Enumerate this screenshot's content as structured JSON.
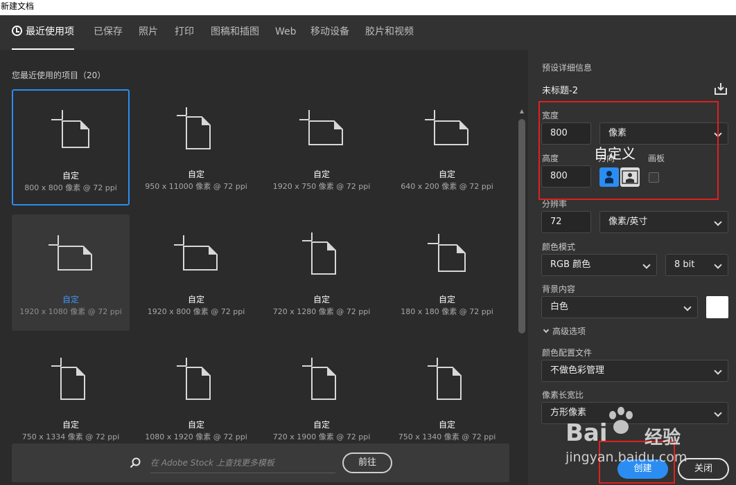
{
  "window": {
    "title": "新建文档"
  },
  "tabs": [
    {
      "label": "最近使用项",
      "active": true
    },
    {
      "label": "已保存"
    },
    {
      "label": "照片"
    },
    {
      "label": "打印"
    },
    {
      "label": "图稿和插图"
    },
    {
      "label": "Web"
    },
    {
      "label": "移动设备"
    },
    {
      "label": "胶片和视频"
    }
  ],
  "recent": {
    "heading": "您最近使用的项目（20）",
    "items": [
      {
        "name": "自定",
        "dim": "800 x 800 像素 @ 72 ppi",
        "orientation": "square",
        "state": "selected"
      },
      {
        "name": "自定",
        "dim": "950 x 11000 像素 @ 72 ppi",
        "orientation": "portrait"
      },
      {
        "name": "自定",
        "dim": "1920 x 750 像素 @ 72 ppi",
        "orientation": "landscape"
      },
      {
        "name": "自定",
        "dim": "640 x 200 像素 @ 72 ppi",
        "orientation": "landscape"
      },
      {
        "name": "自定",
        "dim": "1920 x 1080 像素 @ 72 ppi",
        "orientation": "landscape",
        "state": "hover"
      },
      {
        "name": "自定",
        "dim": "1920 x 800 像素 @ 72 ppi",
        "orientation": "landscape"
      },
      {
        "name": "自定",
        "dim": "720 x 1280 像素 @ 72 ppi",
        "orientation": "portrait"
      },
      {
        "name": "自定",
        "dim": "180 x 180 像素 @ 72 ppi",
        "orientation": "square"
      },
      {
        "name": "自定",
        "dim": "750 x 1334 像素 @ 72 ppi",
        "orientation": "portrait"
      },
      {
        "name": "自定",
        "dim": "1080 x 1920 像素 @ 72 ppi",
        "orientation": "portrait"
      },
      {
        "name": "自定",
        "dim": "720 x 1900 像素 @ 72 ppi",
        "orientation": "portrait"
      },
      {
        "name": "自定",
        "dim": "750 x 1340 像素 @ 72 ppi",
        "orientation": "portrait"
      }
    ]
  },
  "search": {
    "placeholder": "在 Adobe Stock 上查找更多模板",
    "button": "前往"
  },
  "preset": {
    "heading": "预设详细信息",
    "doc_name": "未标题-2",
    "width_label": "宽度",
    "width_value": "800",
    "width_unit": "像素",
    "height_label": "高度",
    "height_value": "800",
    "orientation_label": "方向",
    "artboard_label": "画板",
    "resolution_label": "分辨率",
    "resolution_value": "72",
    "resolution_unit": "像素/英寸",
    "color_mode_label": "颜色模式",
    "color_mode_value": "RGB 颜色",
    "bit_depth": "8 bit",
    "background_label": "背景内容",
    "background_value": "白色",
    "background_color": "#ffffff",
    "advanced_label": "高级选项",
    "color_profile_label": "颜色配置文件",
    "color_profile_value": "不做色彩管理",
    "pixel_aspect_label": "像素长宽比",
    "pixel_aspect_value": "方形像素"
  },
  "actions": {
    "create": "创建",
    "close": "关闭"
  },
  "annotation": {
    "text": "自定义",
    "color": "#e02020"
  },
  "watermark": {
    "brand_left": "Bai",
    "brand_right": "经验",
    "url": "jingyan.baidu.com"
  },
  "colors": {
    "accent": "#2b8df2"
  }
}
